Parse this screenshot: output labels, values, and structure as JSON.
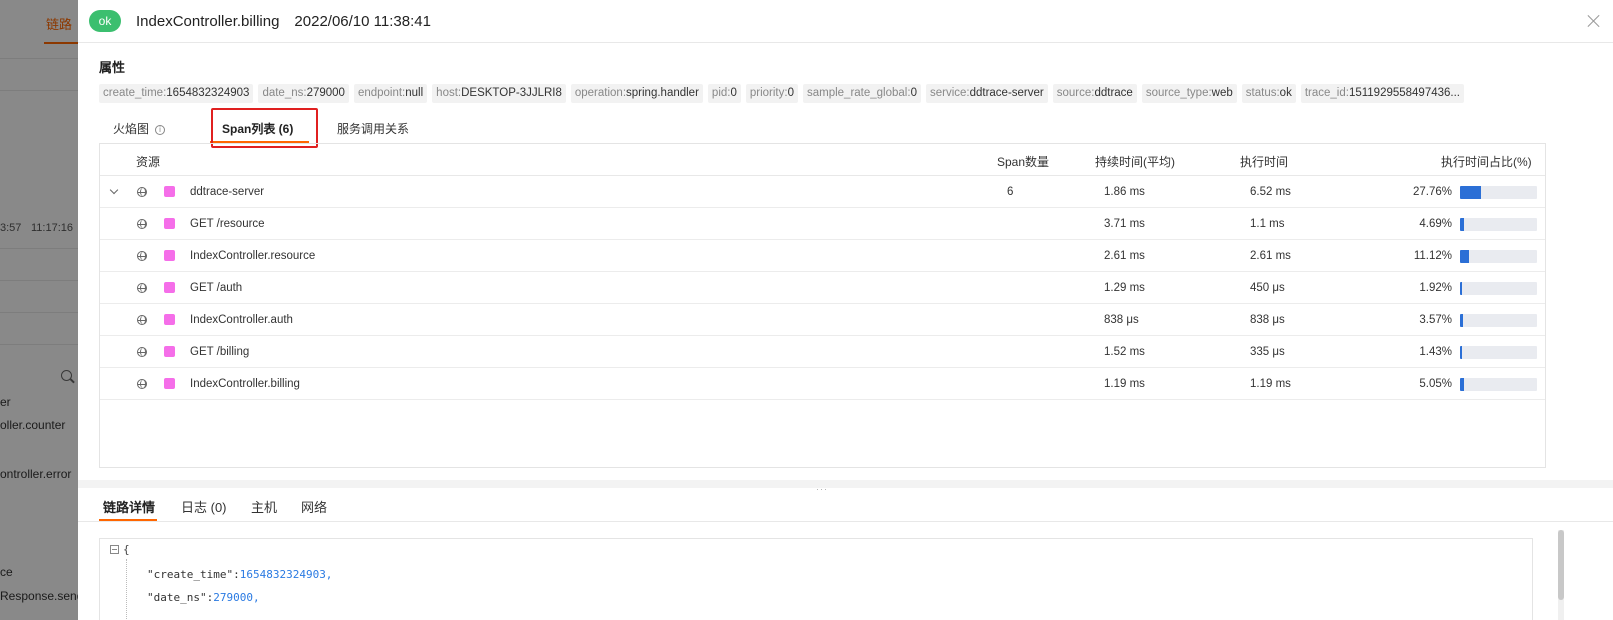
{
  "background": {
    "tab_label": "链路",
    "time_left": "3:57",
    "time_right": "11:17:16",
    "items": [
      "er",
      "oller.counter",
      "ontroller.error",
      "ce",
      "Response.sendE"
    ]
  },
  "header": {
    "status": "ok",
    "title": "IndexController.billing",
    "time": "2022/06/10 11:38:41"
  },
  "attributes": {
    "title": "属性",
    "tags": [
      {
        "key": "create_time:",
        "value": "1654832324903"
      },
      {
        "key": "date_ns:",
        "value": "279000"
      },
      {
        "key": "endpoint:",
        "value": "null"
      },
      {
        "key": "host:",
        "value": "DESKTOP-3JJLRI8"
      },
      {
        "key": "operation:",
        "value": "spring.handler"
      },
      {
        "key": "pid:",
        "value": "0"
      },
      {
        "key": "priority:",
        "value": "0"
      },
      {
        "key": "sample_rate_global:",
        "value": "0"
      },
      {
        "key": "service:",
        "value": "ddtrace-server"
      },
      {
        "key": "source:",
        "value": "ddtrace"
      },
      {
        "key": "source_type:",
        "value": "web"
      },
      {
        "key": "status:",
        "value": "ok"
      },
      {
        "key": "trace_id:",
        "value": "1511929558497436..."
      }
    ]
  },
  "tabs": {
    "flame": "火焰图",
    "info": "i",
    "span_list": "Span列表 (6)",
    "service_map": "服务调用关系"
  },
  "table": {
    "headers": {
      "resource": "资源",
      "span_count": "Span数量",
      "avg_duration": "持续时间(平均)",
      "exec_time": "执行时间",
      "exec_pct": "执行时间占比(%)"
    },
    "rows": [
      {
        "resource": "ddtrace-server",
        "span_count": "6",
        "avg_duration": "1.86 ms",
        "exec_time": "6.52 ms",
        "pct_label": "27.76%",
        "pct": 27.76
      },
      {
        "resource": "GET /resource",
        "span_count": "",
        "avg_duration": "3.71 ms",
        "exec_time": "1.1 ms",
        "pct_label": "4.69%",
        "pct": 4.69
      },
      {
        "resource": "IndexController.resource",
        "span_count": "",
        "avg_duration": "2.61 ms",
        "exec_time": "2.61 ms",
        "pct_label": "11.12%",
        "pct": 11.12
      },
      {
        "resource": "GET /auth",
        "span_count": "",
        "avg_duration": "1.29 ms",
        "exec_time": "450 μs",
        "pct_label": "1.92%",
        "pct": 1.92
      },
      {
        "resource": "IndexController.auth",
        "span_count": "",
        "avg_duration": "838 μs",
        "exec_time": "838 μs",
        "pct_label": "3.57%",
        "pct": 3.57
      },
      {
        "resource": "GET /billing",
        "span_count": "",
        "avg_duration": "1.52 ms",
        "exec_time": "335 μs",
        "pct_label": "1.43%",
        "pct": 1.43
      },
      {
        "resource": "IndexController.billing",
        "span_count": "",
        "avg_duration": "1.19 ms",
        "exec_time": "1.19 ms",
        "pct_label": "5.05%",
        "pct": 5.05
      }
    ],
    "service_color": "#f56ee9",
    "bar_color": "#2b6fd6"
  },
  "drag_handle": "···",
  "bottom_tabs": [
    "链路详情",
    "日志 (0)",
    "主机",
    "网络"
  ],
  "json_view": {
    "open_brace": "{",
    "lines": [
      {
        "key": "\"create_time\":",
        "value": "1654832324903,"
      },
      {
        "key": "\"date_ns\":",
        "value": "279000,"
      }
    ]
  }
}
